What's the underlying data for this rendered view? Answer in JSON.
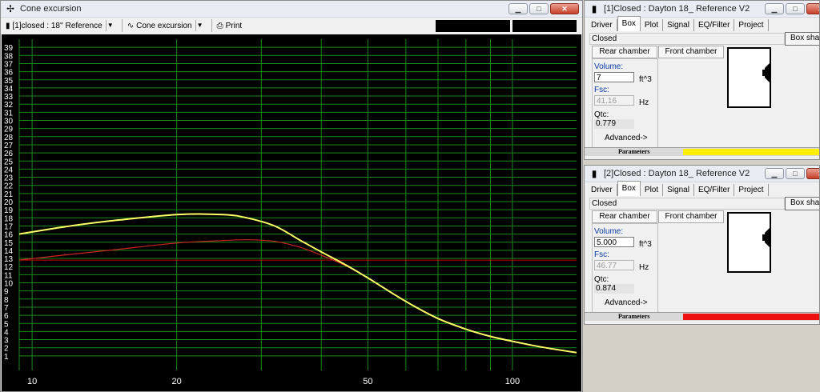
{
  "main_window": {
    "title": "Cone excursion",
    "toolbar": {
      "project_select": "[1]closed : 18'' Reference",
      "plot_select": "Cone excursion",
      "print_label": "Print"
    }
  },
  "chart_data": {
    "type": "line",
    "xscale": "log",
    "xlim": [
      9.4,
      136
    ],
    "ylim": [
      0,
      40
    ],
    "x_tick_labels": [
      {
        "value": 10,
        "label": "10"
      },
      {
        "value": 20,
        "label": "20"
      },
      {
        "value": 50,
        "label": "50"
      },
      {
        "value": 100,
        "label": "100"
      }
    ],
    "x_gridlines": [
      10,
      20,
      30,
      40,
      50,
      60,
      70,
      80,
      90,
      100
    ],
    "y_ticks": [
      1,
      2,
      3,
      4,
      5,
      6,
      7,
      8,
      9,
      10,
      11,
      12,
      13,
      14,
      15,
      16,
      17,
      18,
      19,
      20,
      21,
      22,
      23,
      24,
      25,
      26,
      27,
      28,
      29,
      30,
      31,
      32,
      33,
      34,
      35,
      36,
      37,
      38,
      39
    ],
    "grid": true,
    "colors": {
      "background": "#000000",
      "grid": "#1a8a1a",
      "text": "#ffffff"
    },
    "reference_line": {
      "y": 12.8,
      "color": "#cc0000"
    },
    "series": [
      {
        "color": "#ffff66",
        "x": [
          9.4,
          12,
          15,
          20,
          25,
          28,
          32,
          36,
          40,
          45,
          50,
          60,
          70,
          80,
          90,
          100,
          110,
          120,
          136
        ],
        "y": [
          16,
          17,
          17.7,
          18.4,
          18.4,
          18,
          17,
          15.3,
          13.8,
          12.2,
          10.6,
          7.7,
          5.6,
          4.3,
          3.4,
          2.8,
          2.3,
          1.9,
          1.4
        ]
      },
      {
        "color": "#cc2222",
        "x": [
          9.4,
          12,
          15,
          20,
          25,
          28,
          32,
          36,
          40,
          45,
          50,
          60,
          70,
          80,
          90,
          100,
          110,
          120,
          136
        ],
        "y": [
          12.8,
          13.5,
          14.1,
          14.9,
          15.2,
          15.3,
          15.1,
          14.4,
          13.4,
          12.1,
          10.6,
          7.7,
          5.6,
          4.3,
          3.4,
          2.8,
          2.3,
          1.9,
          1.4
        ]
      }
    ]
  },
  "box_windows": [
    {
      "title": "[1]Closed : Dayton 18_ Reference V2",
      "tabs": [
        "Driver",
        "Box",
        "Plot",
        "Signal",
        "EQ/Filter",
        "Project"
      ],
      "active_tab": "Box",
      "box_type": "Closed",
      "box_shape_label": "Box shape",
      "rear_chamber_label": "Rear chamber",
      "front_chamber_label": "Front chamber",
      "volume_label": "Volume:",
      "volume_value": "7",
      "volume_unit": "ft^3",
      "fsc_label": "Fsc:",
      "fsc_value": "41.16",
      "fsc_unit": "Hz",
      "qtc_label": "Qtc:",
      "qtc_value": "0.779",
      "advanced_label": "Advanced->",
      "parameters_label": "Parameters",
      "param_color": "#ffee00"
    },
    {
      "title": "[2]Closed : Dayton 18_ Reference V2",
      "tabs": [
        "Driver",
        "Box",
        "Plot",
        "Signal",
        "EQ/Filter",
        "Project"
      ],
      "active_tab": "Box",
      "box_type": "Closed",
      "box_shape_label": "Box shape",
      "rear_chamber_label": "Rear chamber",
      "front_chamber_label": "Front chamber",
      "volume_label": "Volume:",
      "volume_value": "5.000",
      "volume_unit": "ft^3",
      "fsc_label": "Fsc:",
      "fsc_value": "46.77",
      "fsc_unit": "Hz",
      "qtc_label": "Qtc:",
      "qtc_value": "0.874",
      "advanced_label": "Advanced->",
      "parameters_label": "Parameters",
      "param_color": "#ee1111"
    }
  ]
}
